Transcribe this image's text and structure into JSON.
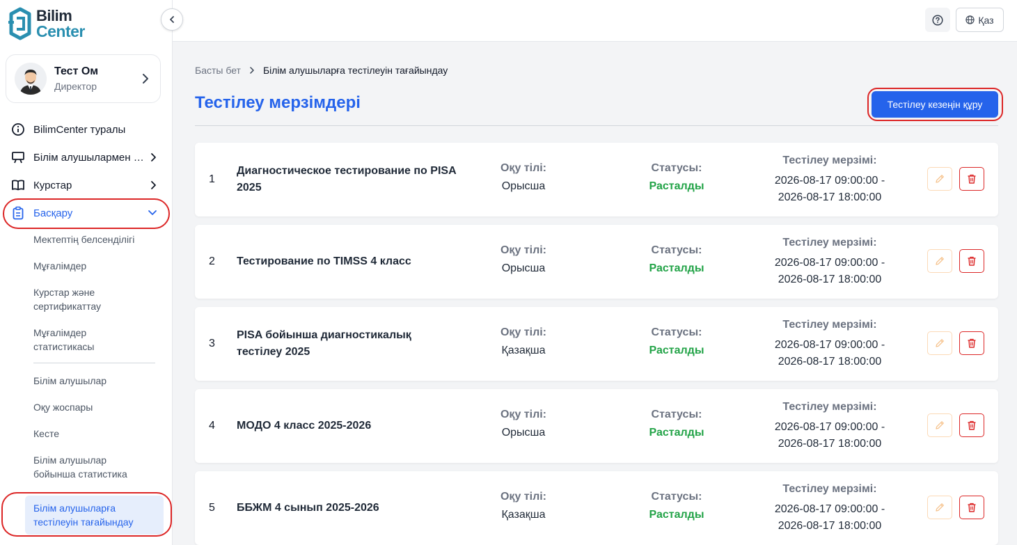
{
  "app": {
    "logo": {
      "line1": "Bilim",
      "line2": "Center"
    }
  },
  "profile": {
    "name": "Тест Ом",
    "role": "Директор"
  },
  "nav": {
    "about": "BilimCenter туралы",
    "students": "Білім алушылармен жұмыс",
    "courses": "Курстар",
    "manage": "Басқару"
  },
  "submenu": [
    "Мектептің белсенділігі",
    "Мұғалімдер",
    "Курстар және сертификаттау",
    "Мұғалімдер статистикасы",
    "Білім алушылар",
    "Оқу жоспары",
    "Кесте",
    "Білім алушылар бойынша статистика",
    "Білім алушыларға тестілеуін тағайындау"
  ],
  "topbar": {
    "language": "Қаз"
  },
  "breadcrumb": {
    "home": "Басты бет",
    "current": "Білім алушыларға тестілеуін тағайындау"
  },
  "page": {
    "title": "Тестілеу мерзімдері",
    "create_button": "Тестілеу кезеңін құру"
  },
  "labels": {
    "language": "Оқу тілі:",
    "status": "Статусы:",
    "period": "Тестілеу мерзімі:"
  },
  "colors": {
    "accent": "#2563eb",
    "status_green": "#22a347",
    "danger": "#dc2626"
  },
  "rows": [
    {
      "num": "1",
      "title": "Диагностическое тестирование по PISA 2025",
      "language": "Орысша",
      "status": "Расталды",
      "start": "2026-08-17 09:00:00 -",
      "end": "2026-08-17 18:00:00"
    },
    {
      "num": "2",
      "title": "Тестирование по TIMSS 4 класс",
      "language": "Орысша",
      "status": "Расталды",
      "start": "2026-08-17 09:00:00 -",
      "end": "2026-08-17 18:00:00"
    },
    {
      "num": "3",
      "title": "PISA бойынша диагностикалық тестілеу 2025",
      "language": "Қазақша",
      "status": "Расталды",
      "start": "2026-08-17 09:00:00 -",
      "end": "2026-08-17 18:00:00"
    },
    {
      "num": "4",
      "title": "МОДО 4 класс 2025-2026",
      "language": "Орысша",
      "status": "Расталды",
      "start": "2026-08-17 09:00:00 -",
      "end": "2026-08-17 18:00:00"
    },
    {
      "num": "5",
      "title": "ББЖМ 4 сынып 2025-2026",
      "language": "Қазақша",
      "status": "Расталды",
      "start": "2026-08-17 09:00:00 -",
      "end": "2026-08-17 18:00:00"
    }
  ]
}
